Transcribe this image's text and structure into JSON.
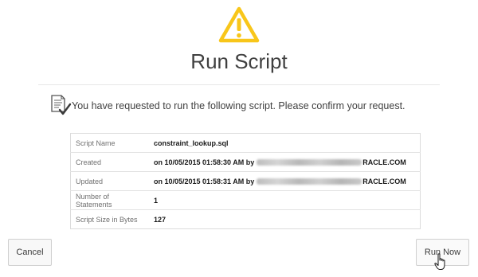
{
  "dialog": {
    "title": "Run Script",
    "message": "You have requested to run the following script. Please confirm your request.",
    "icons": {
      "warning": "warning-triangle-icon",
      "document": "script-document-check-icon",
      "cursor": "hand-pointer-icon"
    },
    "colors": {
      "warning": "#f8c61a",
      "text": "#404040"
    }
  },
  "details": [
    {
      "label": "Script Name",
      "value": "constraint_lookup.sql",
      "suffix": ""
    },
    {
      "label": "Created",
      "value": "on 10/05/2015 01:58:30 AM by",
      "suffix": "RACLE.COM"
    },
    {
      "label": "Updated",
      "value": "on 10/05/2015 01:58:31 AM by",
      "suffix": "RACLE.COM"
    },
    {
      "label": "Number of Statements",
      "value": "1",
      "suffix": ""
    },
    {
      "label": "Script Size in Bytes",
      "value": "127",
      "suffix": ""
    }
  ],
  "buttons": {
    "cancel": "Cancel",
    "run": "Run Now"
  }
}
